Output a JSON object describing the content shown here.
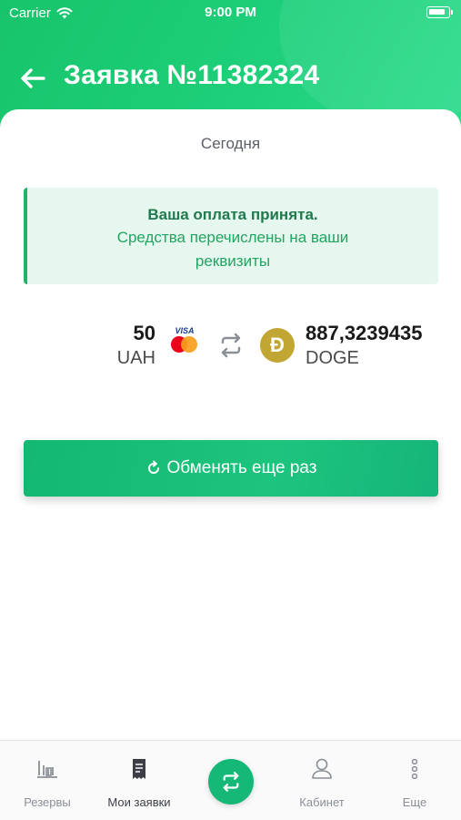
{
  "status_bar": {
    "carrier": "Carrier",
    "time": "9:00 PM"
  },
  "header": {
    "title": "Заявка №11382324"
  },
  "order": {
    "date": "Сегодня",
    "notice": {
      "title": "Ваша оплата принята.",
      "text": "Средства перечислены на ваши реквизиты"
    },
    "from": {
      "amount": "50",
      "currency": "UAH",
      "card_brand": "VISA"
    },
    "to": {
      "amount": "887,3239435",
      "currency": "DOGE",
      "coin_letter": "Đ"
    },
    "repeat_button": "Обменять еще раз"
  },
  "tabbar": {
    "items": [
      {
        "label": "Резервы",
        "icon": "reserves-icon"
      },
      {
        "label": "Мои заявки",
        "icon": "receipt-icon"
      },
      {
        "label": "",
        "icon": "exchange-icon"
      },
      {
        "label": "Кабинет",
        "icon": "user-icon"
      },
      {
        "label": "Еще",
        "icon": "more-icon"
      }
    ]
  },
  "colors": {
    "brand_green": "#1ed07a",
    "accent": "#16b877",
    "notice_bg": "#e6f7ef",
    "doge": "#c2a633"
  }
}
